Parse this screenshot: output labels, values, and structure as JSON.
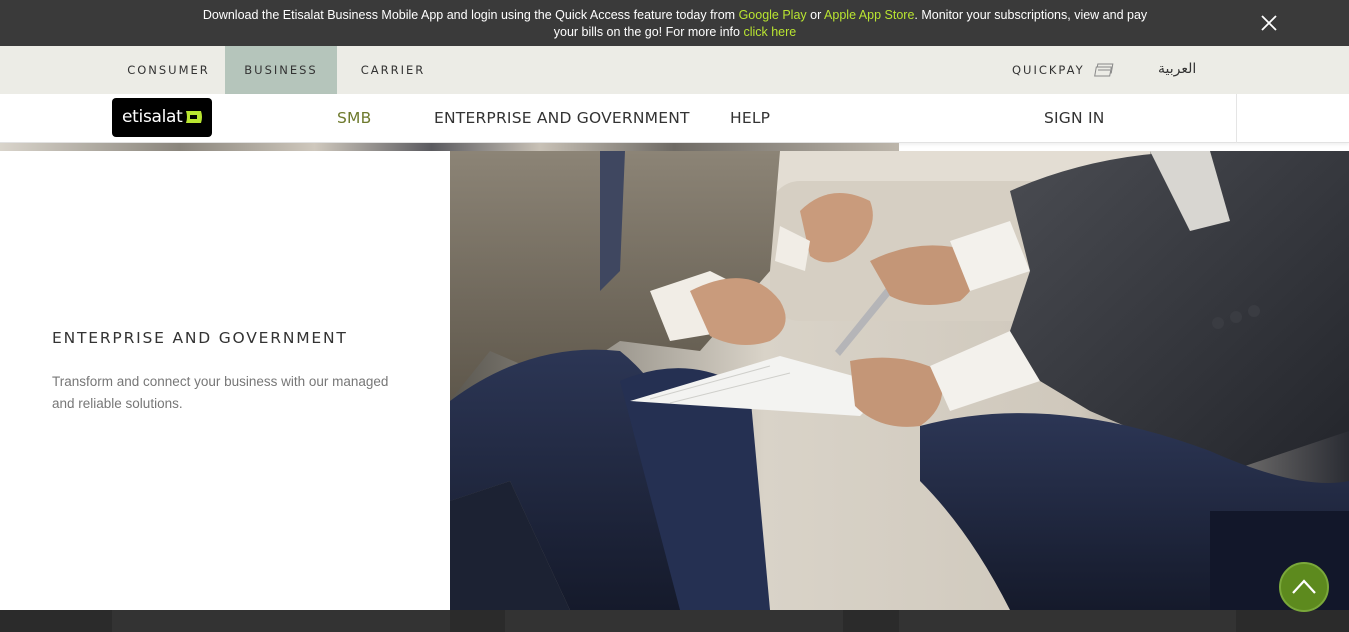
{
  "banner": {
    "text_before": "Download the Etisalat Business Mobile App and login using the Quick Access feature today from ",
    "google_play": "Google Play",
    "or": " or ",
    "app_store": "Apple App Store",
    "text_middle": ". Monitor your subscriptions, view and pay your bills on the go! For more info ",
    "click_here": "click here",
    "close_icon": "close-icon"
  },
  "segments": {
    "items": [
      {
        "label": "CONSUMER",
        "active": false
      },
      {
        "label": "BUSINESS",
        "active": true
      },
      {
        "label": "CARRIER",
        "active": false
      }
    ],
    "quickpay": "QUICKPAY",
    "quickpay_icon": "card-icon",
    "language": "العربية"
  },
  "nav": {
    "logo_text": "etisalat",
    "items": [
      {
        "label": "SMB"
      },
      {
        "label": "ENTERPRISE AND GOVERNMENT"
      },
      {
        "label": "HELP"
      }
    ],
    "sign_in": "SIGN IN"
  },
  "content": {
    "title": "ENTERPRISE AND GOVERNMENT",
    "description": "Transform and connect your business with our managed and reliable solutions."
  },
  "colors": {
    "accent_green": "#b9e531",
    "smb_active": "#6e7a2d",
    "segment_active": "#b5c5bb",
    "scroll_top": "#5d8a1e"
  },
  "scroll_top_icon": "chevron-up-icon"
}
